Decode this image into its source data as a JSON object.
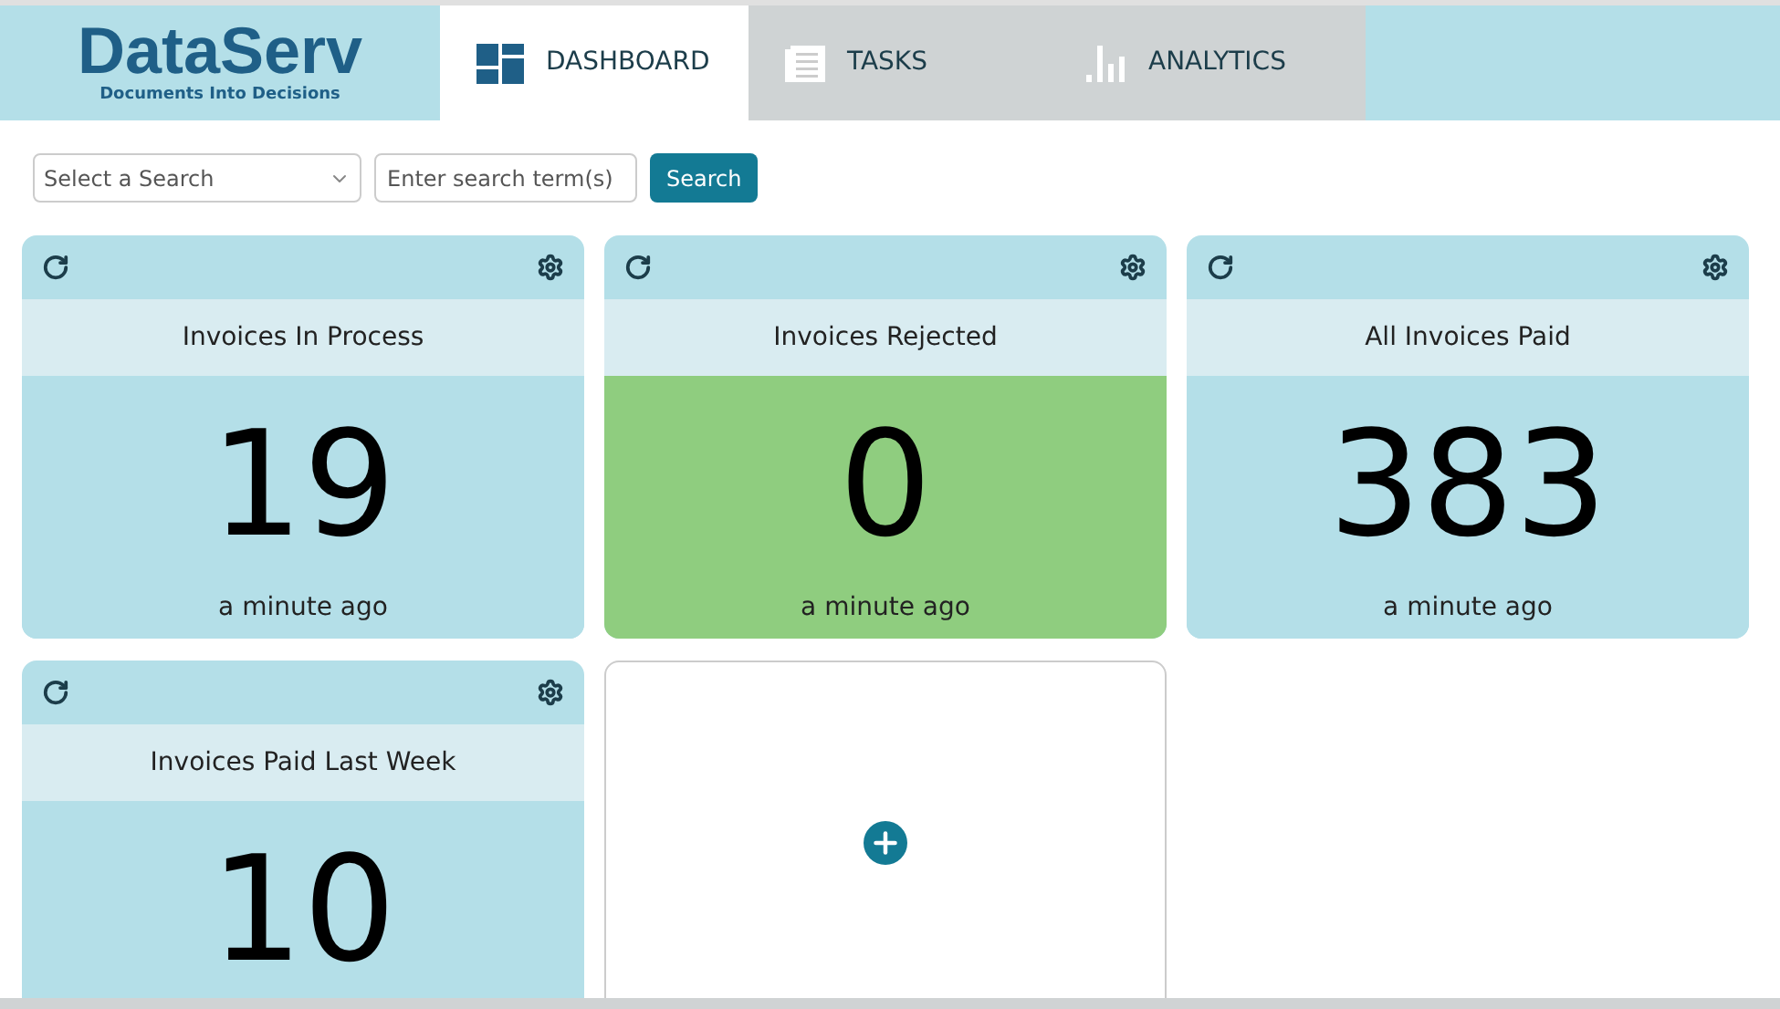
{
  "logo": {
    "name": "DataServ",
    "tagline": "Documents Into Decisions"
  },
  "tabs": [
    {
      "label": "DASHBOARD",
      "selected": true,
      "kind": "dashboard"
    },
    {
      "label": "TASKS",
      "selected": false,
      "kind": "tasks"
    },
    {
      "label": "ANALYTICS",
      "selected": false,
      "kind": "analytics"
    }
  ],
  "search": {
    "select_placeholder": "Select a Search",
    "term_placeholder": "Enter search term(s)",
    "button": "Search"
  },
  "tiles": [
    {
      "kind": "metric",
      "title": "Invoices In Process",
      "value": "19",
      "updated": "a minute ago",
      "color": "#b4dfe8"
    },
    {
      "kind": "metric",
      "title": "Invoices Rejected",
      "value": "0",
      "updated": "a minute ago",
      "color": "#8fcd7f"
    },
    {
      "kind": "metric",
      "title": "All Invoices Paid",
      "value": "383",
      "updated": "a minute ago",
      "color": "#b4dfe8"
    },
    {
      "kind": "metric",
      "title": "Invoices Paid Last Week",
      "value": "10",
      "color": "#b4dfe8"
    },
    {
      "kind": "add"
    }
  ]
}
